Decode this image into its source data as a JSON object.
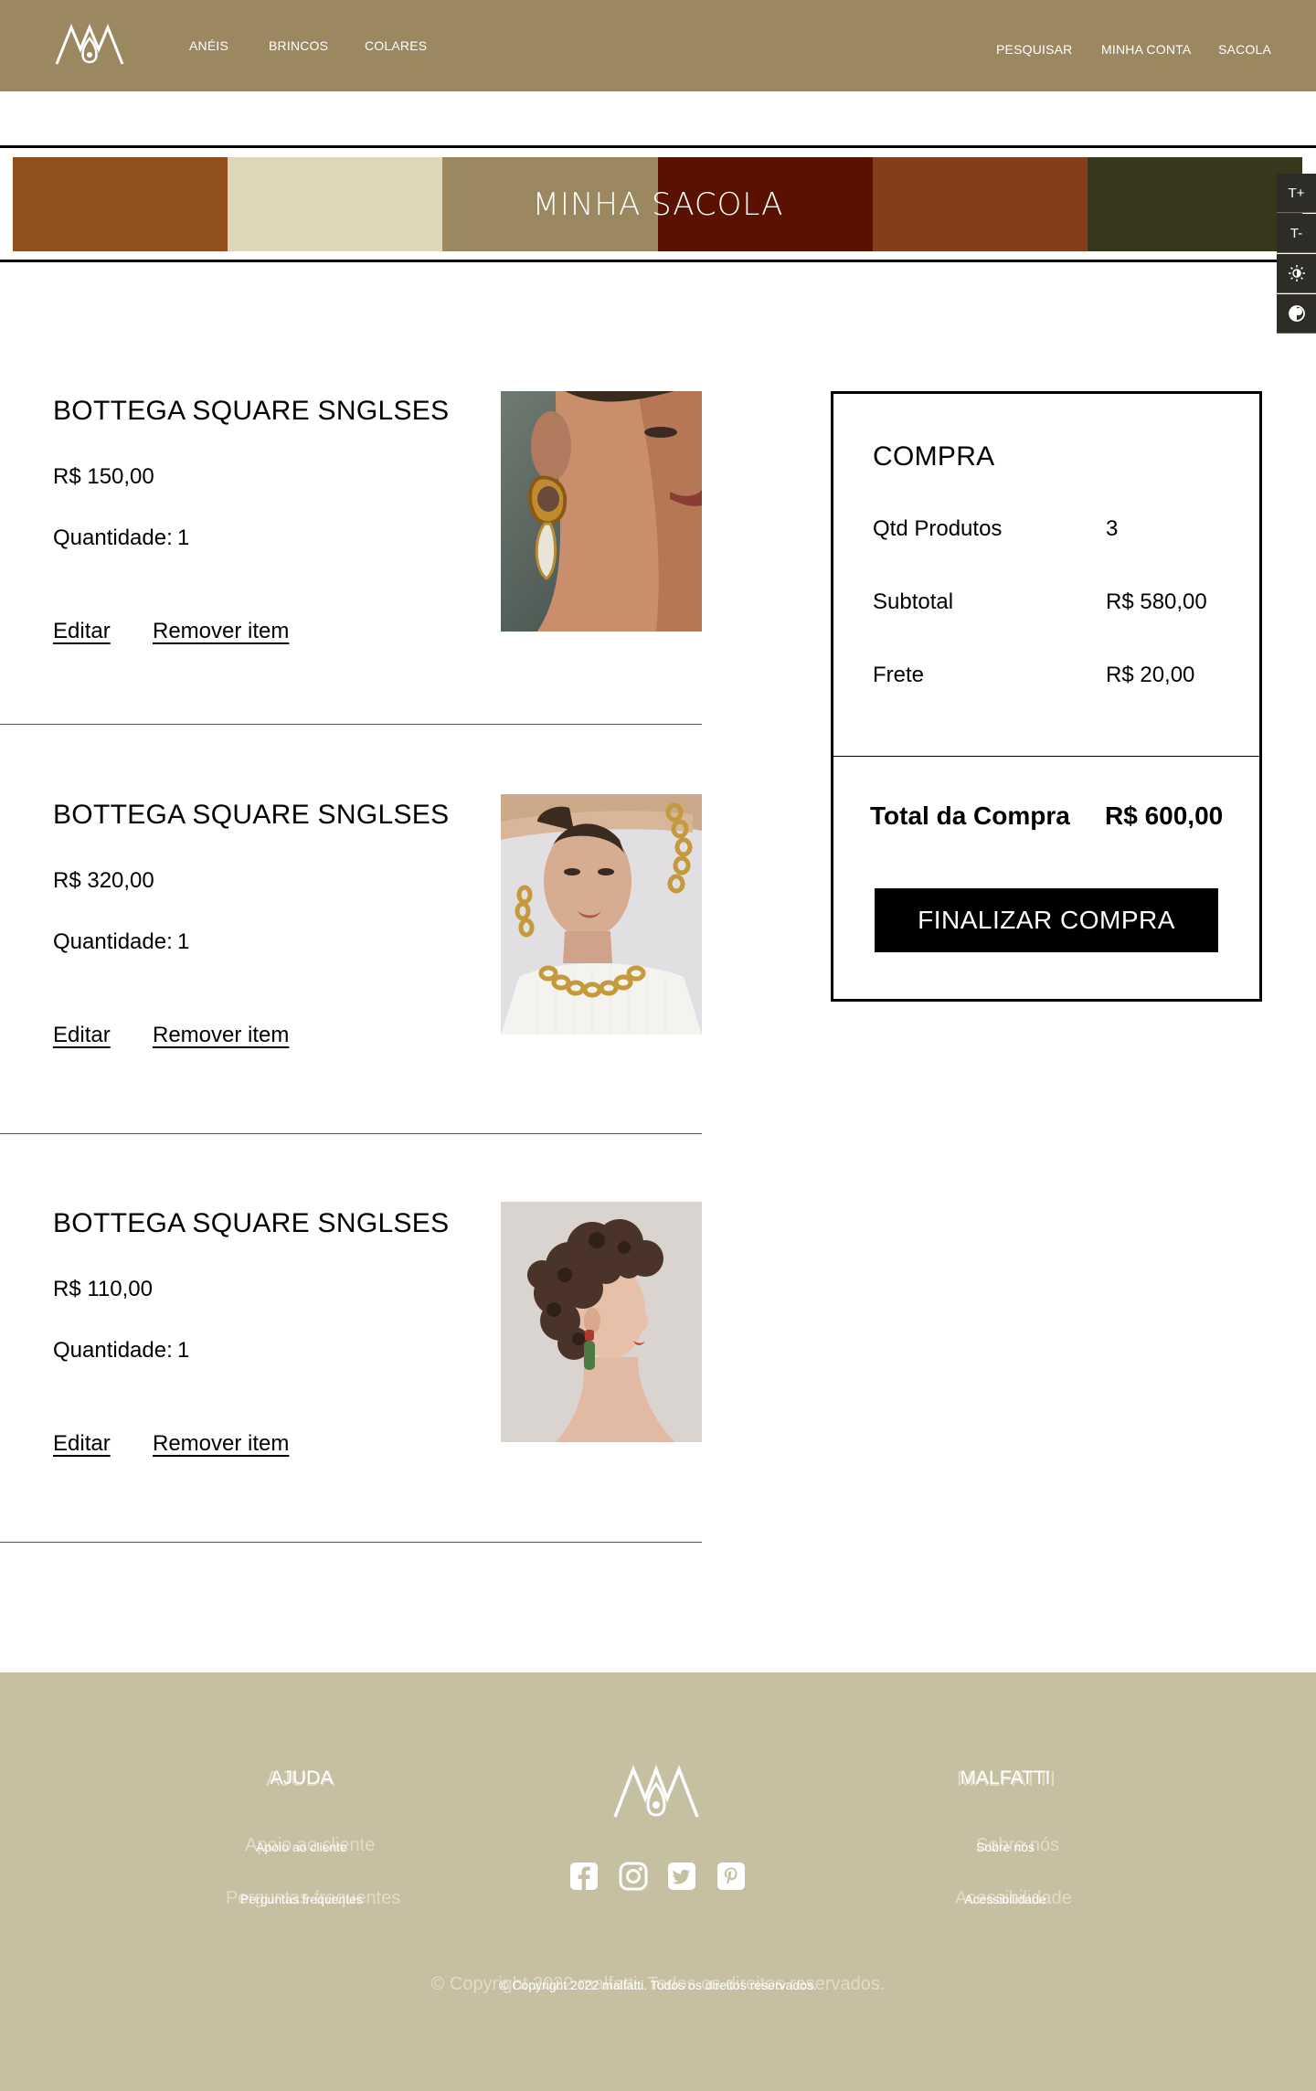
{
  "header": {
    "nav_left": [
      "ANÉIS",
      "BRINCOS",
      "COLARES"
    ],
    "nav_right": [
      "PESQUISAR",
      "MINHA CONTA",
      "SACOLA"
    ]
  },
  "banner": {
    "title": "MINHA SACOLA",
    "swatch_colors": [
      "#93501f",
      "#ddd6b9",
      "#9b8861",
      "#5a1100",
      "#843e1c",
      "#38371d"
    ]
  },
  "accessibility": {
    "buttons": [
      "T+",
      "T-",
      "brightness-icon",
      "contrast-icon"
    ]
  },
  "cart": {
    "items": [
      {
        "name": "BOTTEGA SQUARE SNGLSES",
        "price": "R$ 150,00",
        "qty_label": "Quantidade:",
        "qty": "1",
        "edit": "Editar",
        "remove": "Remover item",
        "image": "earring-model-photo"
      },
      {
        "name": "BOTTEGA SQUARE SNGLSES",
        "price": "R$ 320,00",
        "qty_label": "Quantidade:",
        "qty": "1",
        "edit": "Editar",
        "remove": "Remover item",
        "image": "chain-necklace-model-photo"
      },
      {
        "name": "BOTTEGA SQUARE SNGLSES",
        "price": "R$ 110,00",
        "qty_label": "Quantidade:",
        "qty": "1",
        "edit": "Editar",
        "remove": "Remover item",
        "image": "curly-hair-model-photo"
      }
    ]
  },
  "summary": {
    "title": "COMPRA",
    "rows": [
      {
        "label": "Qtd Produtos",
        "value": "3"
      },
      {
        "label": "Subtotal",
        "value": "R$ 580,00"
      },
      {
        "label": "Frete",
        "value": "R$ 20,00"
      }
    ],
    "total_label": "Total da Compra",
    "total_value": "R$ 600,00",
    "cta": "FINALIZAR COMPRA"
  },
  "footer": {
    "help_title": "AJUDA",
    "help_links": [
      "Apoio ao cliente",
      "Perguntas frequentes"
    ],
    "brand_title": "MALFATTI",
    "brand_links": [
      "Sobre nós",
      "Acessibilidade"
    ],
    "social": [
      "facebook-icon",
      "instagram-icon",
      "twitter-icon",
      "pinterest-icon"
    ],
    "copyright": "© Copyright 2022 malfatti. Todos os direitos reservados."
  },
  "colors": {
    "header_bg": "#9b8861",
    "footer_bg": "#c7bfa2",
    "a11y_bg": "#2e2c26",
    "cta_bg": "#000000"
  }
}
